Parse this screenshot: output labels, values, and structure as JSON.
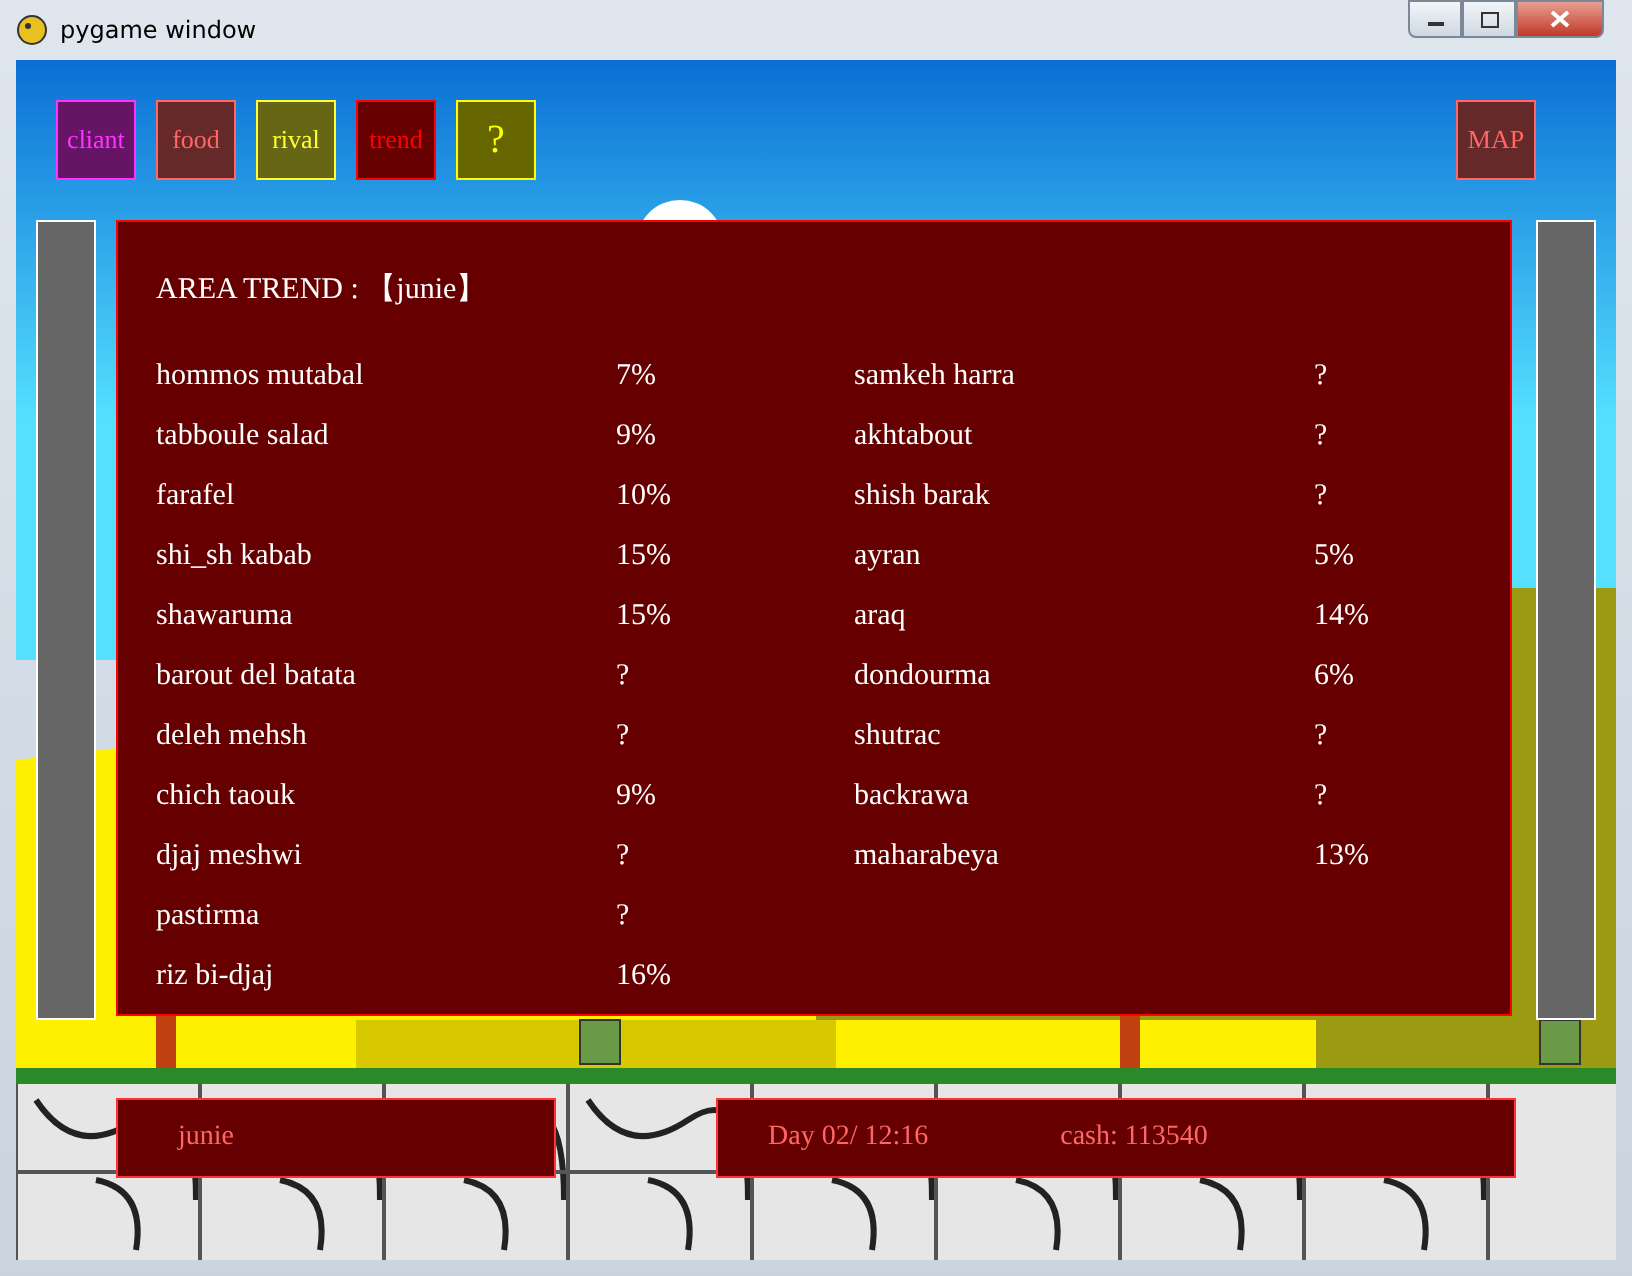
{
  "window": {
    "title": "pygame window"
  },
  "menu_buttons": [
    {
      "label": "cliant",
      "color": "#ff33ff"
    },
    {
      "label": "food",
      "color": "#ff6666"
    },
    {
      "label": "rival",
      "color": "#ffff33"
    },
    {
      "label": "trend",
      "color": "#ff0000"
    },
    {
      "label": "?",
      "color": "#ffff00"
    }
  ],
  "map_button": {
    "label": "MAP",
    "color": "#ff6666"
  },
  "trend_panel": {
    "title": "AREA TREND : 【junie】",
    "columns": [
      [
        {
          "name": "hommos mutabal",
          "value": "7%"
        },
        {
          "name": "tabboule salad",
          "value": "9%"
        },
        {
          "name": "farafel",
          "value": "10%"
        },
        {
          "name": "shi_sh kabab",
          "value": "15%"
        },
        {
          "name": "shawaruma",
          "value": "15%"
        },
        {
          "name": "barout del batata",
          "value": "?"
        },
        {
          "name": "deleh mehsh",
          "value": "?"
        },
        {
          "name": "chich taouk",
          "value": "9%"
        },
        {
          "name": "djaj meshwi",
          "value": "?"
        },
        {
          "name": "pastirma",
          "value": "?"
        },
        {
          "name": "riz bi-djaj",
          "value": "16%"
        }
      ],
      [
        {
          "name": "samkeh harra",
          "value": "?"
        },
        {
          "name": "akhtabout",
          "value": "?"
        },
        {
          "name": "shish barak",
          "value": "?"
        },
        {
          "name": "ayran",
          "value": "5%"
        },
        {
          "name": "araq",
          "value": "14%"
        },
        {
          "name": "dondourma",
          "value": "6%"
        },
        {
          "name": "shutrac",
          "value": "?"
        },
        {
          "name": "backrawa",
          "value": "?"
        },
        {
          "name": "maharabeya",
          "value": "13%"
        }
      ]
    ]
  },
  "status": {
    "player": "junie",
    "day": "Day 02/ 12:16",
    "cash": "cash: 113540"
  }
}
